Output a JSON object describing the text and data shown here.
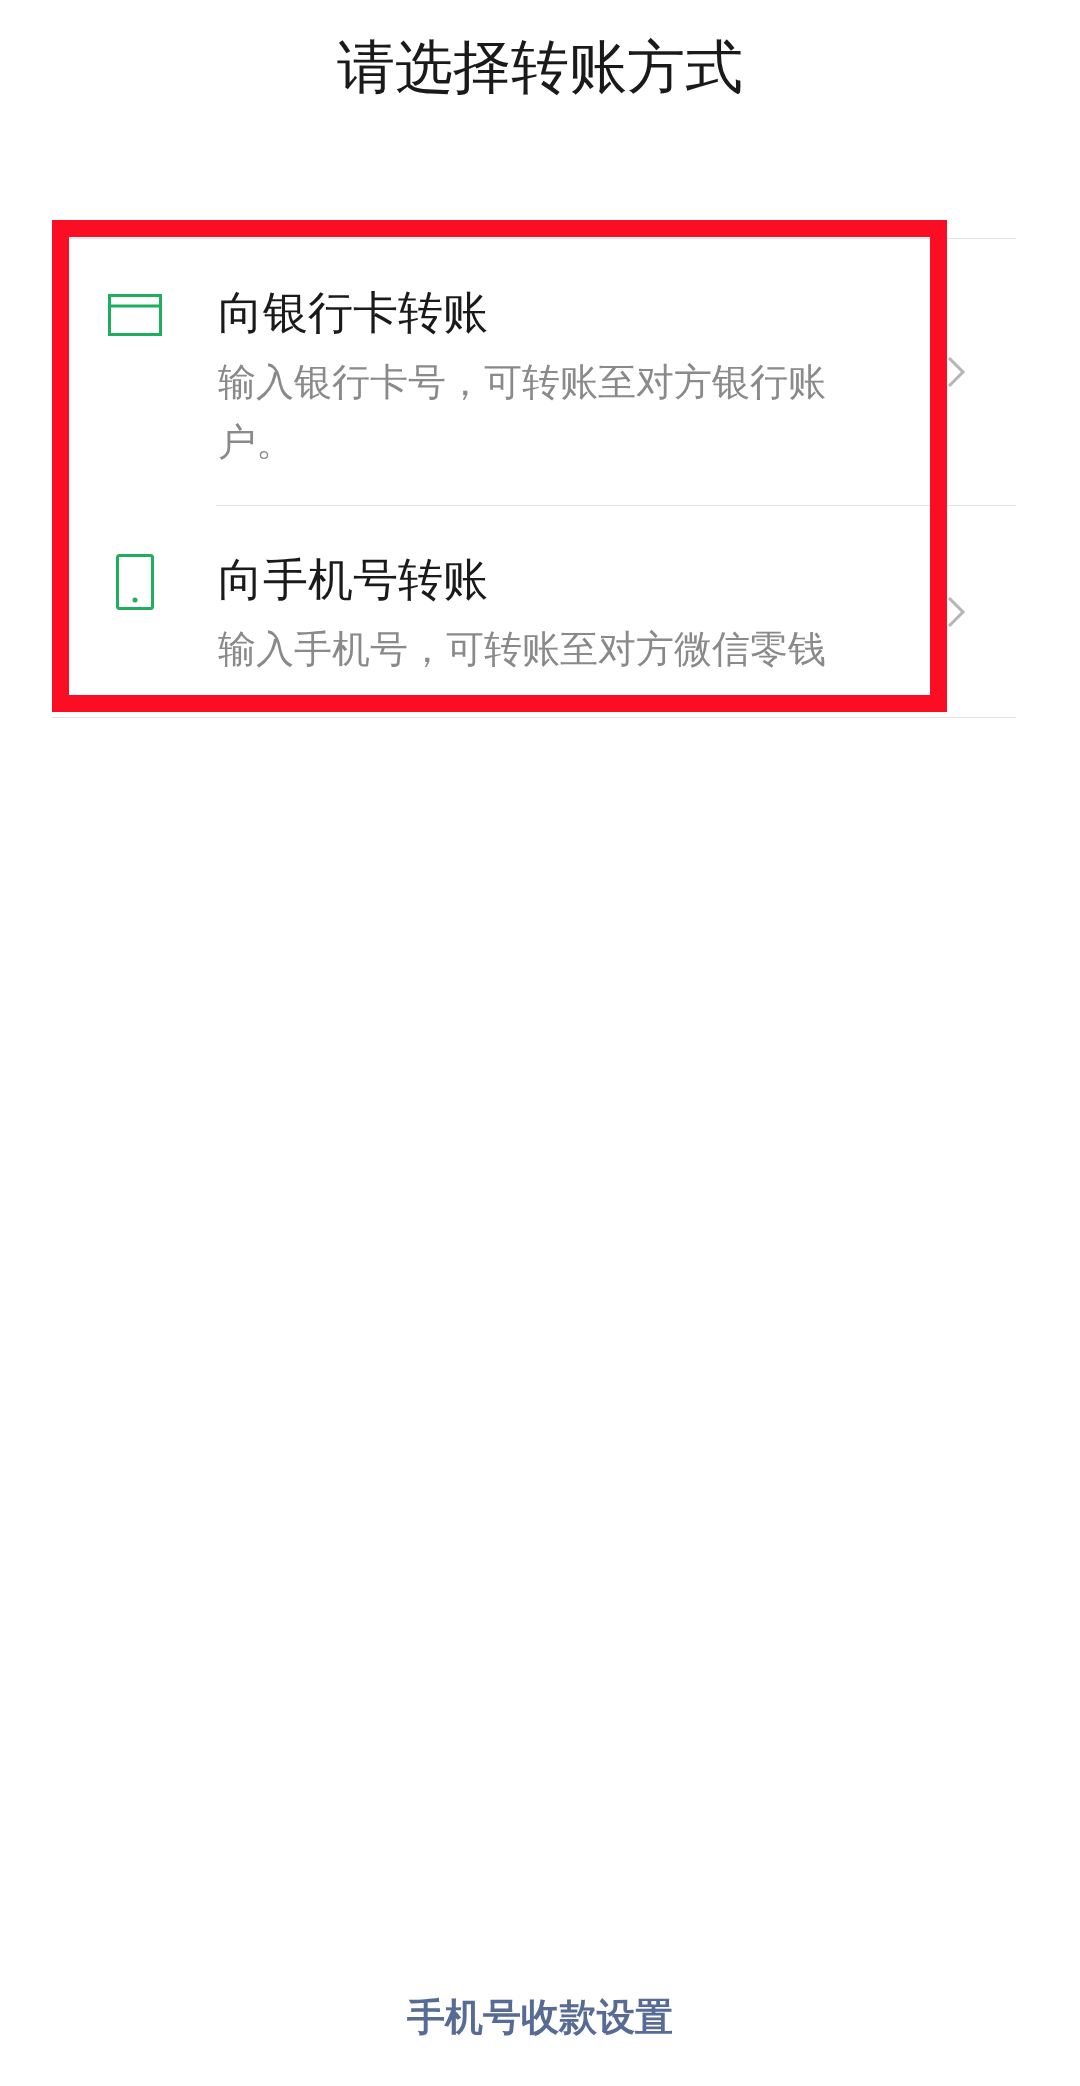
{
  "title": "请选择转账方式",
  "options": [
    {
      "kind": "bank_card",
      "title": "向银行卡转账",
      "description": "输入银行卡号，可转账至对方银行账户。"
    },
    {
      "kind": "phone",
      "title": "向手机号转账",
      "description": "输入手机号，可转账至对方微信零钱"
    }
  ],
  "annotation": {
    "kind": "frame"
  },
  "footer_link": "手机号收款设置"
}
